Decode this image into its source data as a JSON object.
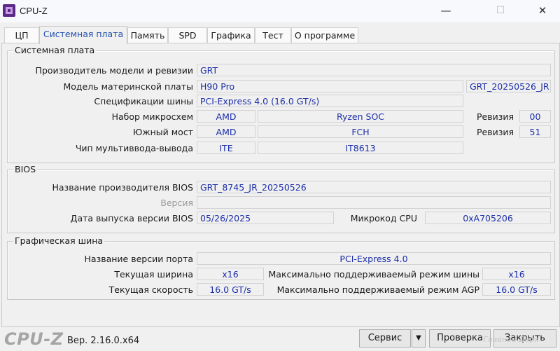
{
  "window": {
    "title": "CPU-Z"
  },
  "controls": {
    "minimize": "—",
    "maximize": "☐",
    "close": "✕"
  },
  "tabs": [
    "ЦП",
    "Системная плата",
    "Память",
    "SPD",
    "Графика",
    "Тест",
    "О программе"
  ],
  "motherboard": {
    "title": "Системная плата",
    "manufacturer_label": "Производитель модели и ревизии",
    "manufacturer": "GRT",
    "model_label": "Модель материнской платы",
    "model": "H90 Pro",
    "model_rev": "GRT_20250526_JR",
    "bus_label": "Спецификации шины",
    "bus": "PCI-Express 4.0 (16.0 GT/s)",
    "chipset_label": "Набор микросхем",
    "chipset_vendor": "AMD",
    "chipset_model": "Ryzen SOC",
    "chipset_rev_label": "Ревизия",
    "chipset_rev": "00",
    "southbridge_label": "Южный мост",
    "southbridge_vendor": "AMD",
    "southbridge_model": "FCH",
    "southbridge_rev_label": "Ревизия",
    "southbridge_rev": "51",
    "lpcio_label": "Чип мультиввода-вывода",
    "lpcio_vendor": "ITE",
    "lpcio_model": "IT8613"
  },
  "bios": {
    "title": "BIOS",
    "brand_label": "Название производителя BIOS",
    "brand": "GRT_8745_JR_20250526",
    "version_label": "Версия",
    "version": "",
    "date_label": "Дата выпуска версии BIOS",
    "date": "05/26/2025",
    "microcode_label": "Микрокод CPU",
    "microcode": "0xA705206"
  },
  "graphic": {
    "title": "Графическая шина",
    "version_label": "Название версии порта",
    "version": "PCI-Express 4.0",
    "width_label": "Текущая ширина",
    "width": "x16",
    "max_width_label": "Максимально поддерживаемый режим шины",
    "max_width": "x16",
    "speed_label": "Текущая скорость",
    "speed": "16.0 GT/s",
    "max_speed_label": "Максимально поддерживаемый режим AGP",
    "max_speed": "16.0 GT/s"
  },
  "footer": {
    "logo": "CPU-Z",
    "version": "Вер. 2.16.0.x64",
    "service": "Сервис",
    "dropdown": "▼",
    "validate": "Проверка",
    "close": "Закрыть",
    "watermark": "Главное Дарк"
  }
}
